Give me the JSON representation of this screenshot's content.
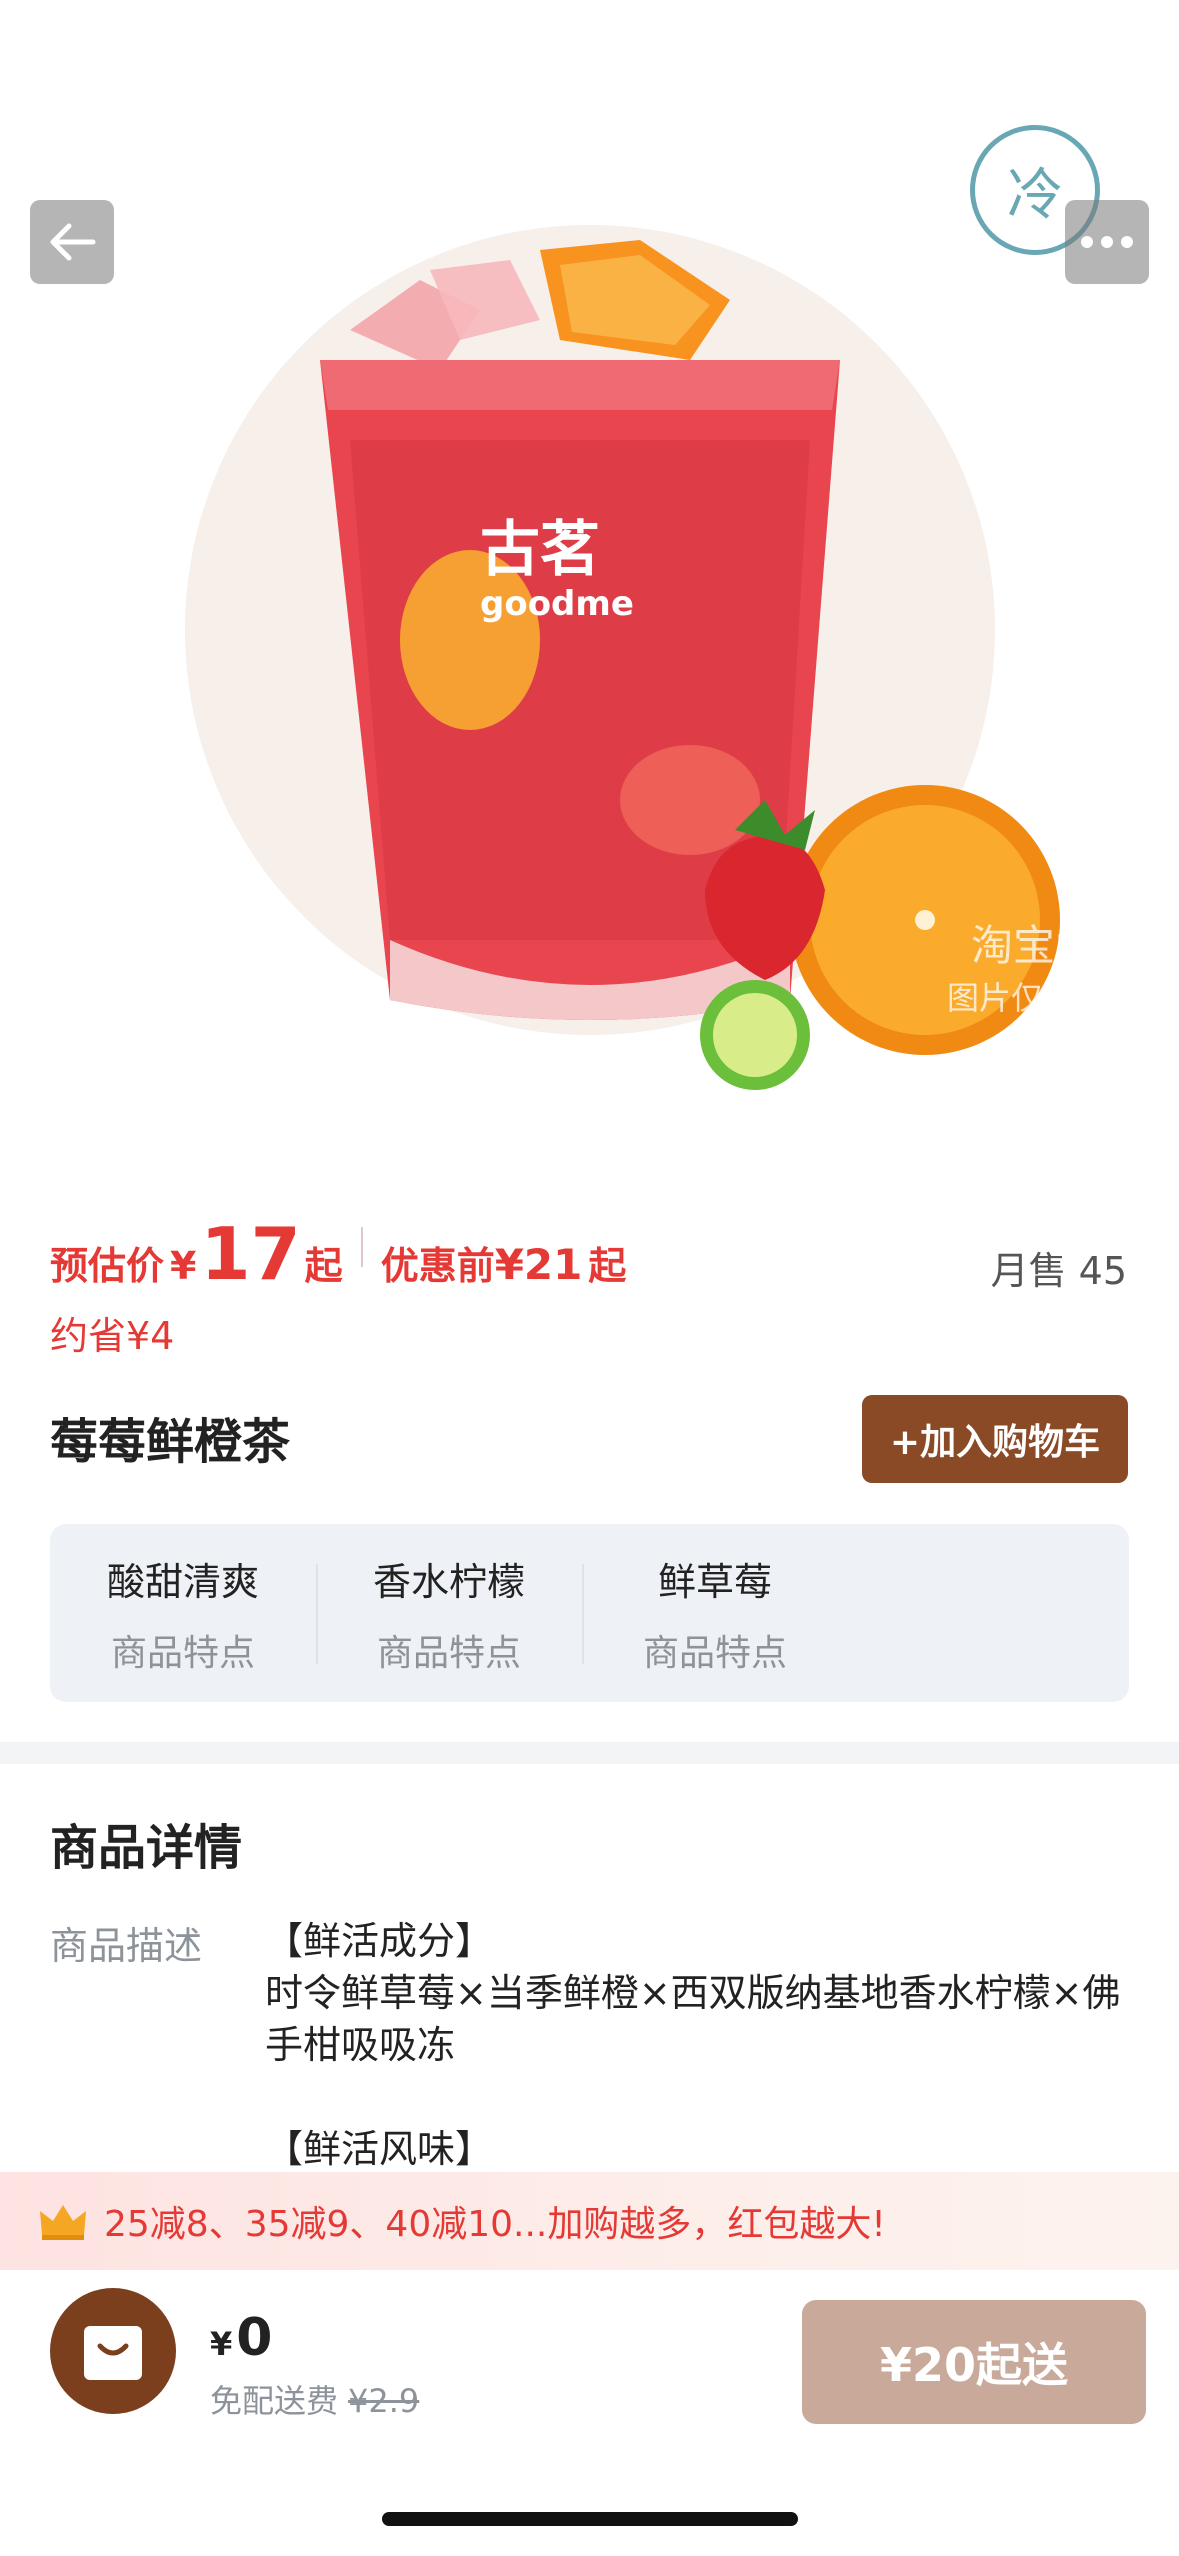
{
  "hero": {
    "cup_brand_cn": "古茗",
    "cup_brand_en": "goodme",
    "cold_badge": "冷",
    "watermark_line1": "淘宝闪购",
    "watermark_line2": "图片仅供参考"
  },
  "price": {
    "estimated_label": "预估价",
    "currency": "¥",
    "estimated_value": "17",
    "from_suffix": "起",
    "original_label": "优惠前",
    "original_value": "¥21",
    "saving": "约省¥4",
    "monthly_sales": "月售 45"
  },
  "product": {
    "name": "莓莓鲜橙茶",
    "add_to_cart_label": "+加入购物车"
  },
  "features": [
    {
      "name": "酸甜清爽",
      "label": "商品特点"
    },
    {
      "name": "香水柠檬",
      "label": "商品特点"
    },
    {
      "name": "鲜草莓",
      "label": "商品特点"
    }
  ],
  "details": {
    "title": "商品详情",
    "desc_label": "商品描述",
    "desc_text": "【鲜活成分】\n时令鲜草莓×当季鲜橙×西双版纳基地香水柠檬×佛手柑吸吸冻\n\n【鲜活风味】"
  },
  "promo": {
    "text": "25减8、35减9、40减10...加购越多，红包越大!"
  },
  "cart": {
    "currency": "¥",
    "total": "0",
    "delivery_label": "免配送费",
    "delivery_original": "¥2.9",
    "checkout_label": "¥20起送"
  },
  "colors": {
    "accent_red": "#e53935",
    "brand_brown": "#8a4a25",
    "checkout_disabled": "#c9a99a"
  }
}
